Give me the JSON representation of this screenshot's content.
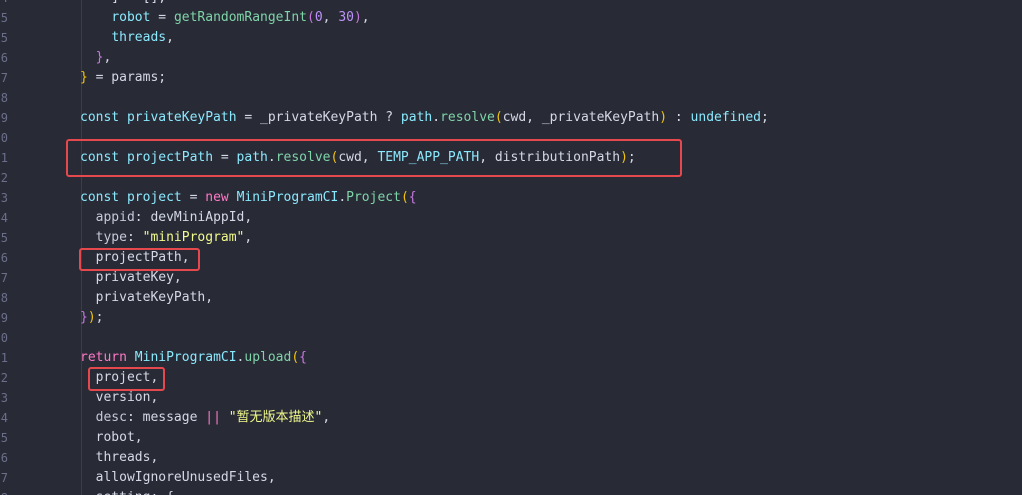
{
  "lines": [
    {
      "n": "4",
      "tokens": [
        [
          "punc",
          "    ] = [],"
        ]
      ]
    },
    {
      "n": "5",
      "tokens": [
        [
          "punc",
          "    "
        ],
        [
          "var",
          "robot"
        ],
        [
          "punc",
          " = "
        ],
        [
          "fn",
          "getRandomRangeInt"
        ],
        [
          "brace2",
          "("
        ],
        [
          "num",
          "0"
        ],
        [
          "punc",
          ", "
        ],
        [
          "num",
          "30"
        ],
        [
          "brace2",
          ")"
        ],
        [
          "punc",
          ","
        ]
      ]
    },
    {
      "n": "5",
      "tokens": [
        [
          "punc",
          "    "
        ],
        [
          "var",
          "threads"
        ],
        [
          "punc",
          ","
        ]
      ]
    },
    {
      "n": "6",
      "tokens": [
        [
          "punc",
          "  "
        ],
        [
          "brace2",
          "}"
        ],
        [
          "punc",
          ","
        ]
      ]
    },
    {
      "n": "7",
      "tokens": [
        [
          "brace1",
          "}"
        ],
        [
          "punc",
          " = params;"
        ]
      ]
    },
    {
      "n": "8",
      "tokens": []
    },
    {
      "n": "9",
      "tokens": [
        [
          "decl",
          "const"
        ],
        [
          "punc",
          " "
        ],
        [
          "var",
          "privateKeyPath"
        ],
        [
          "punc",
          " = _privateKeyPath ? "
        ],
        [
          "fn2",
          "path"
        ],
        [
          "punc",
          "."
        ],
        [
          "fn",
          "resolve"
        ],
        [
          "brace1",
          "("
        ],
        [
          "punc",
          "cwd, _privateKeyPath"
        ],
        [
          "brace1",
          ")"
        ],
        [
          "punc",
          " : "
        ],
        [
          "decl",
          "undefined"
        ],
        [
          "punc",
          ";"
        ]
      ]
    },
    {
      "n": "0",
      "tokens": []
    },
    {
      "n": "1",
      "tokens": [
        [
          "decl",
          "const"
        ],
        [
          "punc",
          " "
        ],
        [
          "var",
          "projectPath"
        ],
        [
          "punc",
          " = "
        ],
        [
          "fn2",
          "path"
        ],
        [
          "punc",
          "."
        ],
        [
          "fn",
          "resolve"
        ],
        [
          "brace1",
          "("
        ],
        [
          "punc",
          "cwd, "
        ],
        [
          "var",
          "TEMP_APP_PATH"
        ],
        [
          "punc",
          ", distributionPath"
        ],
        [
          "brace1",
          ")"
        ],
        [
          "punc",
          ";"
        ]
      ]
    },
    {
      "n": "2",
      "tokens": []
    },
    {
      "n": "3",
      "tokens": [
        [
          "decl",
          "const"
        ],
        [
          "punc",
          " "
        ],
        [
          "var",
          "project"
        ],
        [
          "punc",
          " = "
        ],
        [
          "kw",
          "new"
        ],
        [
          "punc",
          " "
        ],
        [
          "cls",
          "MiniProgramCI"
        ],
        [
          "punc",
          "."
        ],
        [
          "fn",
          "Project"
        ],
        [
          "brace1",
          "("
        ],
        [
          "brace2",
          "{"
        ]
      ]
    },
    {
      "n": "4",
      "tokens": [
        [
          "punc",
          "  "
        ],
        [
          "prop",
          "appid"
        ],
        [
          "punc",
          ": devMiniAppId,"
        ]
      ]
    },
    {
      "n": "5",
      "tokens": [
        [
          "punc",
          "  "
        ],
        [
          "prop",
          "type"
        ],
        [
          "punc",
          ": "
        ],
        [
          "str",
          "\"miniProgram\""
        ],
        [
          "punc",
          ","
        ]
      ]
    },
    {
      "n": "6",
      "tokens": [
        [
          "punc",
          "  projectPath,"
        ]
      ]
    },
    {
      "n": "7",
      "tokens": [
        [
          "punc",
          "  privateKey,"
        ]
      ]
    },
    {
      "n": "8",
      "tokens": [
        [
          "punc",
          "  privateKeyPath,"
        ]
      ]
    },
    {
      "n": "9",
      "tokens": [
        [
          "brace2",
          "}"
        ],
        [
          "brace1",
          ")"
        ],
        [
          "punc",
          ";"
        ]
      ]
    },
    {
      "n": "0",
      "tokens": []
    },
    {
      "n": "1",
      "tokens": [
        [
          "kw",
          "return"
        ],
        [
          "punc",
          " "
        ],
        [
          "cls",
          "MiniProgramCI"
        ],
        [
          "punc",
          "."
        ],
        [
          "fn",
          "upload"
        ],
        [
          "brace1",
          "("
        ],
        [
          "brace2",
          "{"
        ]
      ]
    },
    {
      "n": "2",
      "tokens": [
        [
          "punc",
          "  project,"
        ]
      ]
    },
    {
      "n": "3",
      "tokens": [
        [
          "punc",
          "  version,"
        ]
      ]
    },
    {
      "n": "4",
      "tokens": [
        [
          "punc",
          "  "
        ],
        [
          "prop",
          "desc"
        ],
        [
          "punc",
          ": message "
        ],
        [
          "kw",
          "||"
        ],
        [
          "punc",
          " "
        ],
        [
          "str",
          "\"暂无版本描述\""
        ],
        [
          "punc",
          ","
        ]
      ]
    },
    {
      "n": "5",
      "tokens": [
        [
          "punc",
          "  robot,"
        ]
      ]
    },
    {
      "n": "6",
      "tokens": [
        [
          "punc",
          "  threads,"
        ]
      ]
    },
    {
      "n": "7",
      "tokens": [
        [
          "punc",
          "  allowIgnoreUnusedFiles,"
        ]
      ]
    },
    {
      "n": "8",
      "tokens": [
        [
          "punc",
          "  setting: {"
        ]
      ]
    }
  ],
  "colors": {
    "background": "#282a36",
    "highlight_box": "#e5484d"
  }
}
